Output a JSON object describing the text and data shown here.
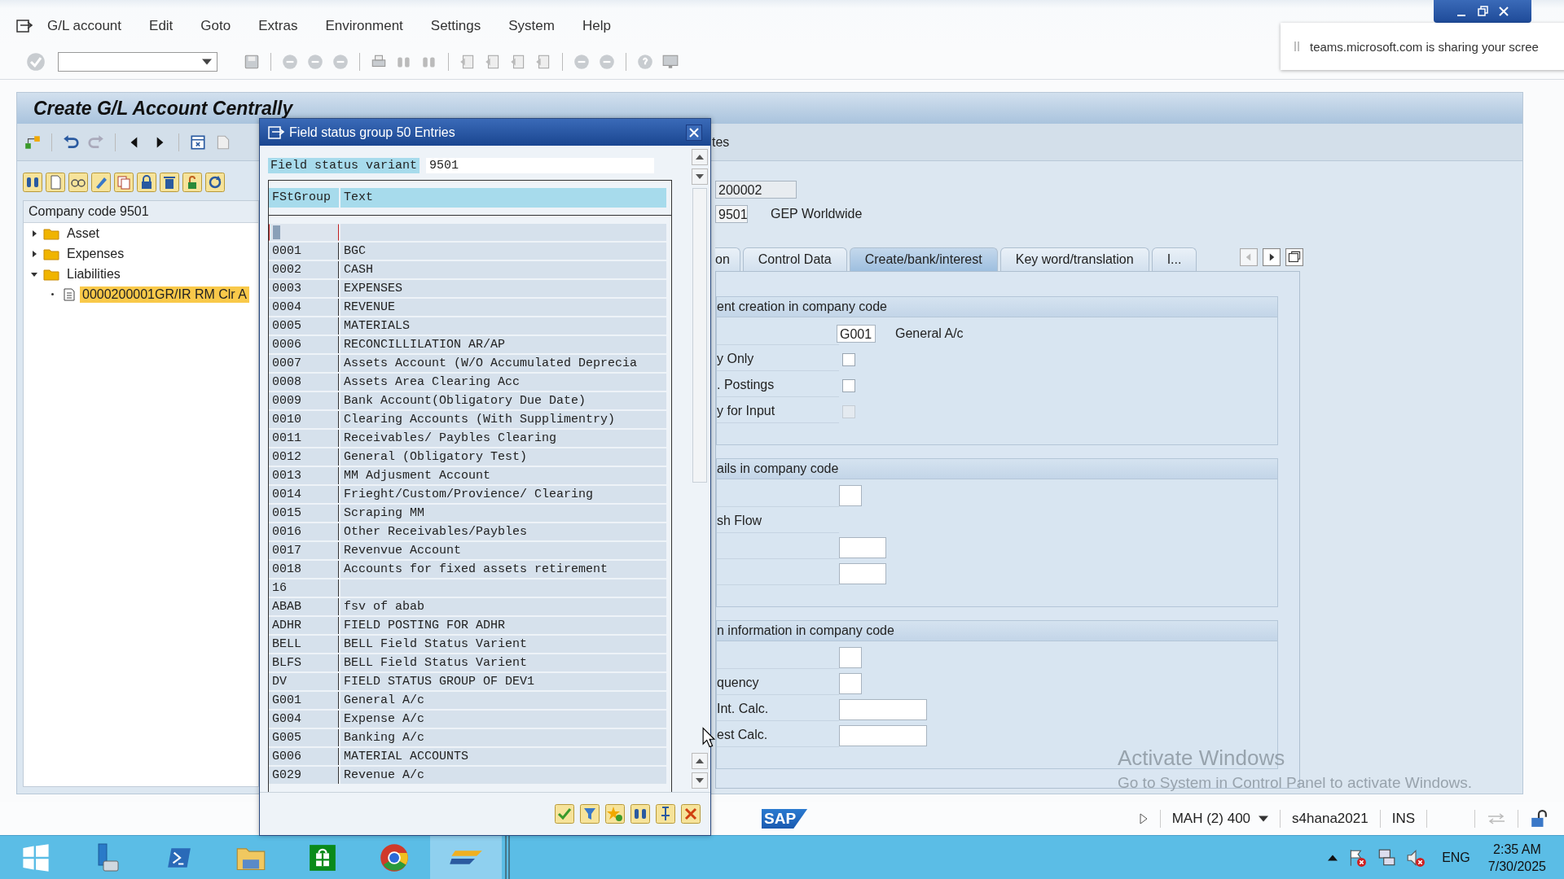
{
  "menu_bar": {
    "items": [
      "G/L account",
      "Edit",
      "Goto",
      "Extras",
      "Environment",
      "Settings",
      "System",
      "Help"
    ]
  },
  "notification": {
    "text": "teams.microsoft.com is sharing your scree"
  },
  "page_title": "Create G/L Account Centrally",
  "tree": {
    "header": "Company code 9501",
    "items": [
      {
        "label": "Asset",
        "kind": "folder",
        "expanded": false,
        "selected": false
      },
      {
        "label": "Expenses",
        "kind": "folder",
        "expanded": false,
        "selected": false
      },
      {
        "label": "Liabilities",
        "kind": "folder",
        "expanded": true,
        "selected": false,
        "children": [
          {
            "label": "0000200001GR/IR RM Clr A",
            "kind": "document",
            "selected": true
          }
        ]
      }
    ]
  },
  "header": {
    "toolbar_text": "tes",
    "account": "200002",
    "company_code": "9501",
    "company_name": "GEP Worldwide"
  },
  "tabs": [
    {
      "label": "on",
      "selected": false
    },
    {
      "label": "Control Data",
      "selected": false
    },
    {
      "label": "Create/bank/interest",
      "selected": true
    },
    {
      "label": "Key word/translation",
      "selected": false
    },
    {
      "label": "I...",
      "selected": false
    }
  ],
  "sections": [
    {
      "title": "ent creation in company code",
      "rows": [
        {
          "kind": "code",
          "value": "G001",
          "description": "General A/c"
        },
        {
          "kind": "checkbox",
          "label": "y Only",
          "checked": false,
          "disabled": false
        },
        {
          "kind": "checkbox",
          "label": ". Postings",
          "checked": false,
          "disabled": false
        },
        {
          "kind": "checkbox",
          "label": "y for Input",
          "checked": false,
          "disabled": true
        }
      ]
    },
    {
      "title": "ails in company code",
      "rows": [
        {
          "kind": "box"
        },
        {
          "kind": "text",
          "label": "sh Flow"
        },
        {
          "kind": "field"
        },
        {
          "kind": "field"
        }
      ]
    },
    {
      "title": "n information in company code",
      "rows": [
        {
          "kind": "box"
        },
        {
          "kind": "box",
          "label": "quency"
        },
        {
          "kind": "wide",
          "label": "Int. Calc."
        },
        {
          "kind": "wide",
          "label": "est Calc."
        }
      ]
    }
  ],
  "dialog": {
    "title": "Field status group 50 Entries",
    "variant_label": "Field status variant",
    "variant_value": "9501",
    "columns": [
      "FStGroup",
      "Text"
    ],
    "rows": [
      {
        "selected": true
      },
      {
        "group": "0001",
        "text": "BGC",
        "selected": false
      },
      {
        "group": "0002",
        "text": "CASH",
        "selected": false
      },
      {
        "group": "0003",
        "text": "EXPENSES",
        "selected": false
      },
      {
        "group": "0004",
        "text": "REVENUE",
        "selected": false
      },
      {
        "group": "0005",
        "text": "MATERIALS",
        "selected": false
      },
      {
        "group": "0006",
        "text": "RECONCILLILATION AR/AP",
        "selected": false
      },
      {
        "group": "0007",
        "text": "Assets Account (W/O Accumulated Deprecia",
        "selected": false
      },
      {
        "group": "0008",
        "text": "Assets Area Clearing Acc",
        "selected": false
      },
      {
        "group": "0009",
        "text": "Bank Account(Obligatory Due Date)",
        "selected": false
      },
      {
        "group": "0010",
        "text": "Clearing Accounts (With Supplimentry)",
        "selected": false
      },
      {
        "group": "0011",
        "text": "Receivables/ Paybles Clearing",
        "selected": false
      },
      {
        "group": "0012",
        "text": "General (Obligatory Test)",
        "selected": false
      },
      {
        "group": "0013",
        "text": "MM Adjusment Account",
        "selected": false
      },
      {
        "group": "0014",
        "text": "Frieght/Custom/Provience/ Clearing",
        "selected": false
      },
      {
        "group": "0015",
        "text": "Scraping MM",
        "selected": false
      },
      {
        "group": "0016",
        "text": "Other Receivables/Paybles",
        "selected": false
      },
      {
        "group": "0017",
        "text": "Revenvue Account",
        "selected": false
      },
      {
        "group": "0018",
        "text": "Accounts for fixed assets retirement",
        "selected": false
      },
      {
        "group": "16",
        "selected": false
      },
      {
        "group": "ABAB",
        "text": "fsv of abab",
        "selected": false
      },
      {
        "group": "ADHR",
        "text": "FIELD POSTING FOR ADHR",
        "selected": false
      },
      {
        "group": "BELL",
        "text": "BELL Field Status Varient",
        "selected": false
      },
      {
        "group": "BLFS",
        "text": "BELL Field Status Varient",
        "selected": false
      },
      {
        "group": "DV",
        "text": "FIELD STATUS GROUP OF DEV1",
        "selected": false
      },
      {
        "group": "G001",
        "text": "General A/c",
        "selected": false
      },
      {
        "group": "G004",
        "text": "Expense A/c",
        "selected": false
      },
      {
        "group": "G005",
        "text": "Banking A/c",
        "selected": false
      },
      {
        "group": "G006",
        "text": "MATERIAL ACCOUNTS",
        "selected": false
      },
      {
        "group": "G029",
        "text": "Revenue A/c",
        "selected": false
      }
    ]
  },
  "activation_notice": {
    "title": "Activate Windows",
    "text": "Go to System in Control Panel to activate Windows."
  },
  "status_bar": {
    "logo": "SAP",
    "system": "MAH (2) 400",
    "server": "s4hana2021",
    "mode": "INS"
  },
  "taskbar": {
    "apps": [
      {
        "kind": "start",
        "selected": false
      },
      {
        "kind": "server",
        "selected": false
      },
      {
        "kind": "shell",
        "selected": false
      },
      {
        "kind": "explorer",
        "selected": false
      },
      {
        "kind": "store",
        "selected": false
      },
      {
        "kind": "browser",
        "selected": false
      },
      {
        "kind": "sap",
        "selected": true
      }
    ],
    "language": "ENG",
    "time": "2:35 AM",
    "date": "7/30/2025"
  }
}
